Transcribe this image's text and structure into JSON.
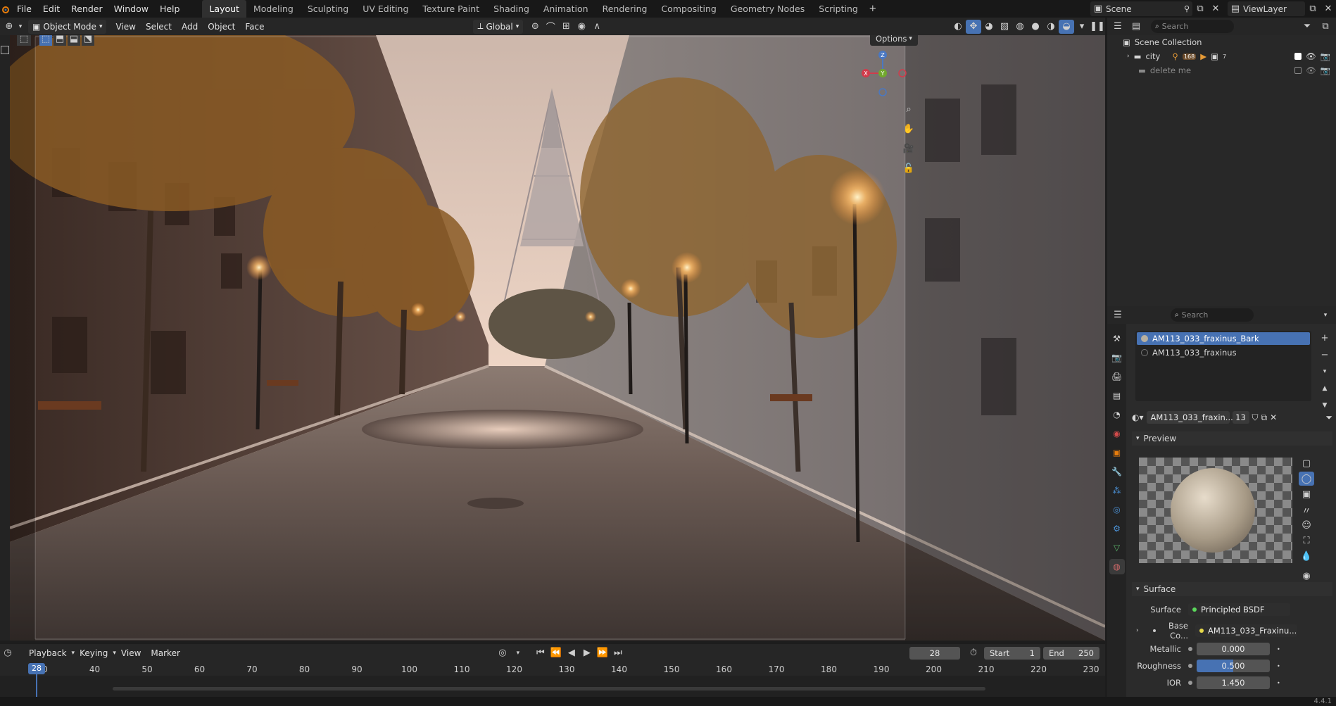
{
  "menubar": {
    "items": [
      "File",
      "Edit",
      "Render",
      "Window",
      "Help"
    ],
    "workspaces": [
      "Layout",
      "Modeling",
      "Sculpting",
      "UV Editing",
      "Texture Paint",
      "Shading",
      "Animation",
      "Rendering",
      "Compositing",
      "Geometry Nodes",
      "Scripting"
    ],
    "active_workspace": "Layout",
    "scene_label": "Scene",
    "viewlayer_label": "ViewLayer"
  },
  "viewport_header": {
    "mode": "Object Mode",
    "menus": [
      "View",
      "Select",
      "Add",
      "Object",
      "Face"
    ],
    "transform": "Global",
    "options": "Options"
  },
  "gizmo": {
    "x": "X",
    "y": "Y",
    "z": "Z"
  },
  "outliner": {
    "search_placeholder": "Search",
    "root": "Scene Collection",
    "items": [
      {
        "label": "city",
        "count": "168",
        "sub": "7"
      },
      {
        "label": "delete me"
      }
    ]
  },
  "properties": {
    "search_placeholder": "Search",
    "material_slots": [
      "AM113_033_fraxinus_Bark",
      "AM113_033_fraxinus"
    ],
    "material_name": "AM113_033_fraxin...",
    "users": "13",
    "preview_label": "Preview",
    "surface_panel": "Surface",
    "surface_label": "Surface",
    "surface_value": "Principled BSDF",
    "base_color_label": "Base Co...",
    "base_color_value": "AM113_033_Fraxinu...",
    "metallic_label": "Metallic",
    "metallic_value": "0.000",
    "roughness_label": "Roughness",
    "roughness_value": "0.500",
    "ior_label": "IOR",
    "ior_value": "1.450"
  },
  "timeline": {
    "menus": [
      "Playback",
      "Keying",
      "View",
      "Marker"
    ],
    "current_frame": "28",
    "start_label": "Start",
    "start_value": "1",
    "end_label": "End",
    "end_value": "250",
    "ticks": [
      "30",
      "40",
      "50",
      "60",
      "70",
      "80",
      "90",
      "100",
      "110",
      "120",
      "130",
      "140",
      "150",
      "160",
      "170",
      "180",
      "190",
      "200",
      "210",
      "220",
      "230"
    ],
    "frame_badge": "28"
  },
  "statusbar": {
    "version": "4.4.1"
  },
  "colors": {
    "accent": "#4772b3",
    "panel": "#2b2b2b",
    "header": "#262626"
  }
}
